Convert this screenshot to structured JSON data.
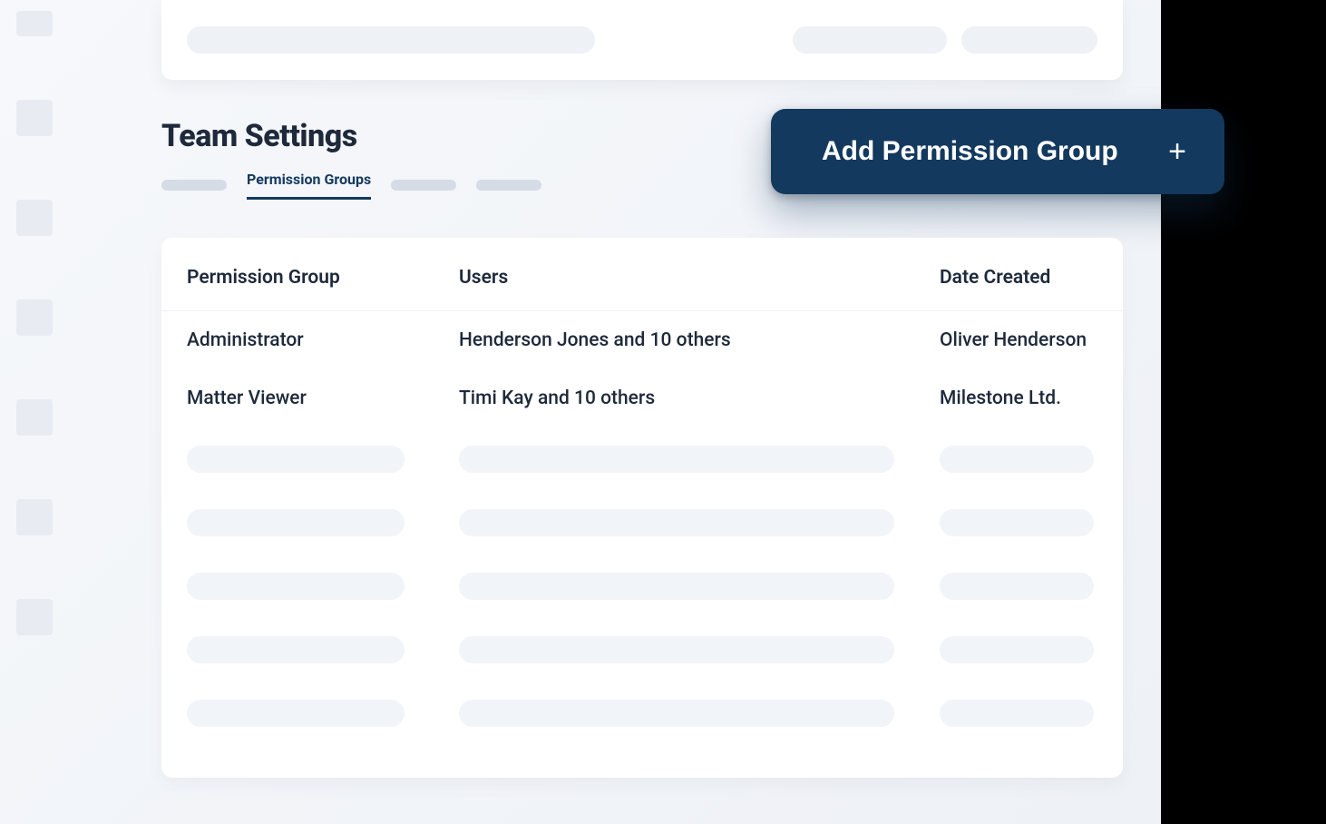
{
  "page": {
    "title": "Team Settings"
  },
  "tabs": {
    "active": "Permission Groups"
  },
  "add_button": {
    "label": "Add Permission Group"
  },
  "table": {
    "headers": {
      "group": "Permission Group",
      "users": "Users",
      "date_created": "Date Created"
    },
    "rows": [
      {
        "group": "Administrator",
        "users": "Henderson Jones and 10 others",
        "date_created": "Oliver Henderson"
      },
      {
        "group": "Matter Viewer",
        "users": "Timi Kay and 10 others",
        "date_created": "Milestone Ltd."
      }
    ]
  }
}
